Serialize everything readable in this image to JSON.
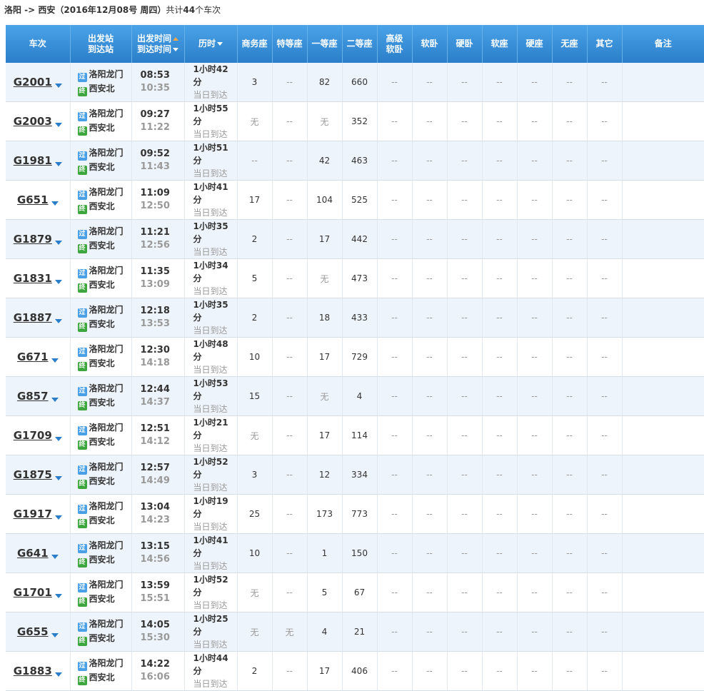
{
  "summary": {
    "route": "洛阳 -> 西安（2016年12月08号  周四）",
    "prefix": "共计",
    "count": "44",
    "suffix": "个车次"
  },
  "headers": {
    "train": "车次",
    "stations_1": "出发站",
    "stations_2": "到达站",
    "times_1": "出发时间",
    "times_2": "到达时间",
    "duration": "历时",
    "business": "商务座",
    "special": "特等座",
    "first": "一等座",
    "second": "二等座",
    "senior_sleeper_1": "高级",
    "senior_sleeper_2": "软卧",
    "soft_sleeper": "软卧",
    "hard_sleeper": "硬卧",
    "soft_seat": "软座",
    "hard_seat": "硬座",
    "no_seat": "无座",
    "other": "其它",
    "remark": "备注"
  },
  "badges": {
    "pass": "过",
    "end": "终"
  },
  "rows": [
    {
      "train": "G2001",
      "from": "洛阳龙门",
      "to": "西安北",
      "dep": "08:53",
      "arr": "10:35",
      "dur": "1小时42分",
      "day": "当日到达",
      "seats": [
        "3",
        "--",
        "82",
        "660",
        "--",
        "--",
        "--",
        "--",
        "--",
        "--",
        "--"
      ]
    },
    {
      "train": "G2003",
      "from": "洛阳龙门",
      "to": "西安北",
      "dep": "09:27",
      "arr": "11:22",
      "dur": "1小时55分",
      "day": "当日到达",
      "seats": [
        "无",
        "--",
        "无",
        "352",
        "--",
        "--",
        "--",
        "--",
        "--",
        "--",
        "--"
      ]
    },
    {
      "train": "G1981",
      "from": "洛阳龙门",
      "to": "西安北",
      "dep": "09:52",
      "arr": "11:43",
      "dur": "1小时51分",
      "day": "当日到达",
      "seats": [
        "--",
        "--",
        "42",
        "463",
        "--",
        "--",
        "--",
        "--",
        "--",
        "--",
        "--"
      ]
    },
    {
      "train": "G651",
      "from": "洛阳龙门",
      "to": "西安北",
      "dep": "11:09",
      "arr": "12:50",
      "dur": "1小时41分",
      "day": "当日到达",
      "seats": [
        "17",
        "--",
        "104",
        "525",
        "--",
        "--",
        "--",
        "--",
        "--",
        "--",
        "--"
      ]
    },
    {
      "train": "G1879",
      "from": "洛阳龙门",
      "to": "西安北",
      "dep": "11:21",
      "arr": "12:56",
      "dur": "1小时35分",
      "day": "当日到达",
      "seats": [
        "2",
        "--",
        "17",
        "442",
        "--",
        "--",
        "--",
        "--",
        "--",
        "--",
        "--"
      ]
    },
    {
      "train": "G1831",
      "from": "洛阳龙门",
      "to": "西安北",
      "dep": "11:35",
      "arr": "13:09",
      "dur": "1小时34分",
      "day": "当日到达",
      "seats": [
        "5",
        "--",
        "无",
        "473",
        "--",
        "--",
        "--",
        "--",
        "--",
        "--",
        "--"
      ]
    },
    {
      "train": "G1887",
      "from": "洛阳龙门",
      "to": "西安北",
      "dep": "12:18",
      "arr": "13:53",
      "dur": "1小时35分",
      "day": "当日到达",
      "seats": [
        "2",
        "--",
        "18",
        "433",
        "--",
        "--",
        "--",
        "--",
        "--",
        "--",
        "--"
      ]
    },
    {
      "train": "G671",
      "from": "洛阳龙门",
      "to": "西安北",
      "dep": "12:30",
      "arr": "14:18",
      "dur": "1小时48分",
      "day": "当日到达",
      "seats": [
        "10",
        "--",
        "17",
        "729",
        "--",
        "--",
        "--",
        "--",
        "--",
        "--",
        "--"
      ]
    },
    {
      "train": "G857",
      "from": "洛阳龙门",
      "to": "西安北",
      "dep": "12:44",
      "arr": "14:37",
      "dur": "1小时53分",
      "day": "当日到达",
      "seats": [
        "15",
        "--",
        "无",
        "4",
        "--",
        "--",
        "--",
        "--",
        "--",
        "--",
        "--"
      ]
    },
    {
      "train": "G1709",
      "from": "洛阳龙门",
      "to": "西安北",
      "dep": "12:51",
      "arr": "14:12",
      "dur": "1小时21分",
      "day": "当日到达",
      "seats": [
        "无",
        "--",
        "17",
        "114",
        "--",
        "--",
        "--",
        "--",
        "--",
        "--",
        "--"
      ]
    },
    {
      "train": "G1875",
      "from": "洛阳龙门",
      "to": "西安北",
      "dep": "12:57",
      "arr": "14:49",
      "dur": "1小时52分",
      "day": "当日到达",
      "seats": [
        "3",
        "--",
        "12",
        "334",
        "--",
        "--",
        "--",
        "--",
        "--",
        "--",
        "--"
      ]
    },
    {
      "train": "G1917",
      "from": "洛阳龙门",
      "to": "西安北",
      "dep": "13:04",
      "arr": "14:23",
      "dur": "1小时19分",
      "day": "当日到达",
      "seats": [
        "25",
        "--",
        "173",
        "773",
        "--",
        "--",
        "--",
        "--",
        "--",
        "--",
        "--"
      ]
    },
    {
      "train": "G641",
      "from": "洛阳龙门",
      "to": "西安北",
      "dep": "13:15",
      "arr": "14:56",
      "dur": "1小时41分",
      "day": "当日到达",
      "seats": [
        "10",
        "--",
        "1",
        "150",
        "--",
        "--",
        "--",
        "--",
        "--",
        "--",
        "--"
      ]
    },
    {
      "train": "G1701",
      "from": "洛阳龙门",
      "to": "西安北",
      "dep": "13:59",
      "arr": "15:51",
      "dur": "1小时52分",
      "day": "当日到达",
      "seats": [
        "无",
        "--",
        "5",
        "67",
        "--",
        "--",
        "--",
        "--",
        "--",
        "--",
        "--"
      ]
    },
    {
      "train": "G655",
      "from": "洛阳龙门",
      "to": "西安北",
      "dep": "14:05",
      "arr": "15:30",
      "dur": "1小时25分",
      "day": "当日到达",
      "seats": [
        "无",
        "无",
        "4",
        "21",
        "--",
        "--",
        "--",
        "--",
        "--",
        "--",
        "--"
      ]
    },
    {
      "train": "G1883",
      "from": "洛阳龙门",
      "to": "西安北",
      "dep": "14:22",
      "arr": "16:06",
      "dur": "1小时44分",
      "day": "当日到达",
      "seats": [
        "2",
        "--",
        "17",
        "406",
        "--",
        "--",
        "--",
        "--",
        "--",
        "--",
        "--"
      ]
    }
  ]
}
